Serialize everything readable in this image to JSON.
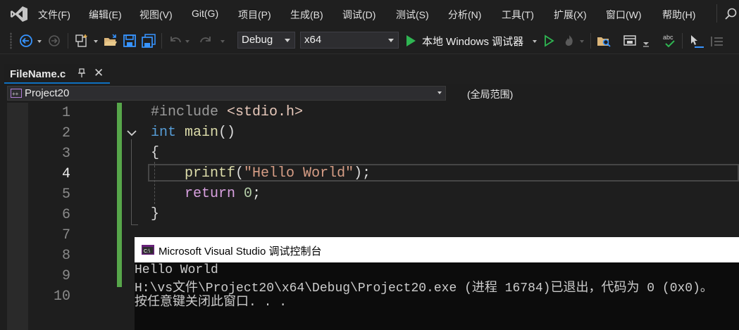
{
  "menubar": {
    "items": [
      "文件(F)",
      "编辑(E)",
      "视图(V)",
      "Git(G)",
      "项目(P)",
      "生成(B)",
      "调试(D)",
      "测试(S)",
      "分析(N)",
      "工具(T)",
      "扩展(X)",
      "窗口(W)",
      "帮助(H)"
    ]
  },
  "toolbar": {
    "configuration": "Debug",
    "platform": "x64",
    "run_label": "本地 Windows 调试器"
  },
  "tab": {
    "filename": "FileName.c",
    "pin_glyph": "ᵖ",
    "close_glyph": "✕"
  },
  "navbar": {
    "project": "Project20",
    "scope": "(全局范围)"
  },
  "editor": {
    "line_numbers": [
      "1",
      "2",
      "3",
      "4",
      "5",
      "6",
      "7",
      "8",
      "9",
      "10"
    ],
    "current_line": 4,
    "code": {
      "l1_directive": "#include",
      "l1_header": "<stdio.h>",
      "l2_type": "int",
      "l2_func": "main",
      "l2_parens": "()",
      "l3_open_brace": "{",
      "l4_func": "printf",
      "l4_open": "(",
      "l4_string": "\"Hello World\"",
      "l4_close": ");",
      "l5_keyword": "return",
      "l5_value": "0",
      "l5_semicolon": ";",
      "l6_close_brace": "}"
    }
  },
  "console": {
    "title": "Microsoft Visual Studio 调试控制台",
    "lines": [
      "Hello World",
      "H:\\vs文件\\Project20\\x64\\Debug\\Project20.exe (进程 16784)已退出，代码为 0 (0x0)。",
      "按任意键关闭此窗口. . ."
    ]
  }
}
